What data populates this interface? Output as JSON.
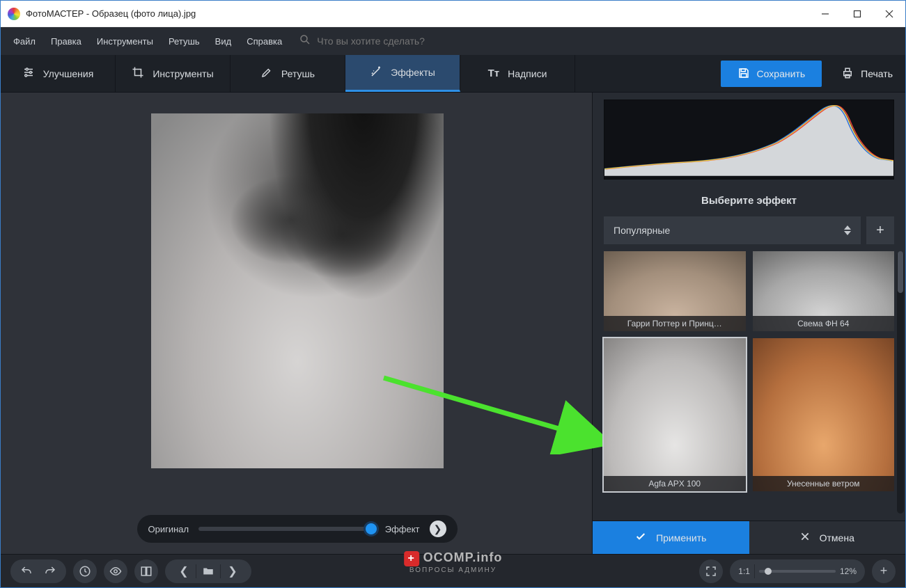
{
  "window": {
    "title": "ФотоМАСТЕР - Образец (фото лица).jpg"
  },
  "menu": {
    "items": [
      "Файл",
      "Правка",
      "Инструменты",
      "Ретушь",
      "Вид",
      "Справка"
    ]
  },
  "search": {
    "placeholder": "Что вы хотите сделать?"
  },
  "tabs": {
    "enhance": "Улучшения",
    "tools": "Инструменты",
    "retouch": "Ретушь",
    "effects": "Эффекты",
    "text": "Надписи"
  },
  "actions": {
    "save": "Сохранить",
    "print": "Печать"
  },
  "slider": {
    "left": "Оригинал",
    "right": "Эффект"
  },
  "panel": {
    "title": "Выберите эффект",
    "category": "Популярные",
    "thumbs": [
      {
        "label": "Гарри Поттер и Принц…"
      },
      {
        "label": "Свема ФН 64"
      },
      {
        "label": "Agfa APX 100"
      },
      {
        "label": "Унесенные ветром"
      }
    ],
    "apply": "Применить",
    "cancel": "Отмена"
  },
  "zoom": {
    "label": "1:1",
    "value": "12%"
  },
  "watermark": {
    "main": "OCOMP.info",
    "sub": "ВОПРОСЫ АДМИНУ"
  }
}
